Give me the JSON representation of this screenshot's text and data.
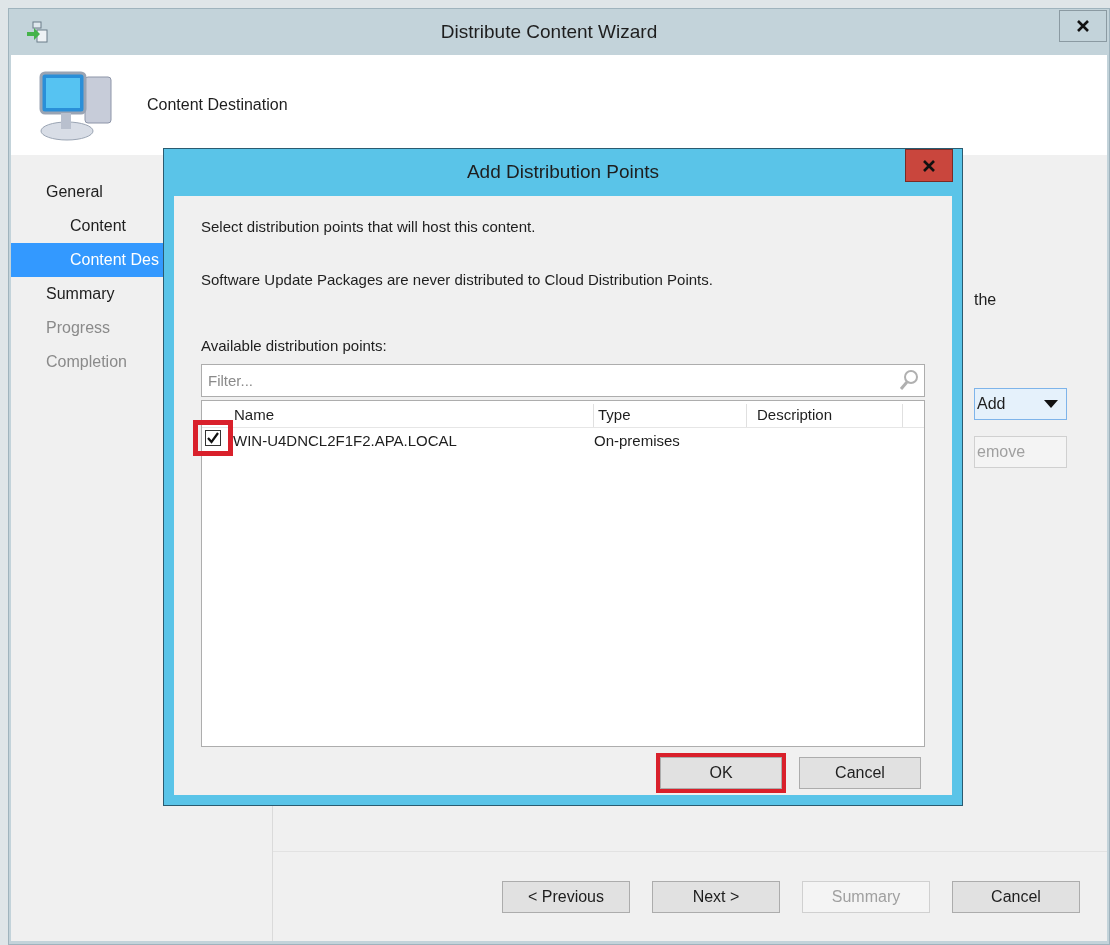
{
  "wizard": {
    "title": "Distribute Content Wizard",
    "page_heading": "Content Destination",
    "nav": [
      {
        "label": "General",
        "selected": false,
        "disabled": false,
        "children": [
          {
            "label": "Content",
            "selected": false,
            "disabled": false
          },
          {
            "label": "Content Des",
            "selected": true,
            "disabled": false
          }
        ]
      },
      {
        "label": "Summary",
        "selected": false,
        "disabled": false
      },
      {
        "label": "Progress",
        "selected": false,
        "disabled": true
      },
      {
        "label": "Completion",
        "selected": false,
        "disabled": true
      }
    ],
    "partial_text": "the",
    "side_buttons": [
      {
        "label": "Add",
        "disabled": false,
        "dropdown": true
      },
      {
        "label": "emove",
        "disabled": true,
        "dropdown": false
      }
    ],
    "footer_buttons": [
      {
        "label": "< Previous",
        "disabled": false
      },
      {
        "label": "Next >",
        "disabled": false
      },
      {
        "label": "Summary",
        "disabled": true
      },
      {
        "label": "Cancel",
        "disabled": false
      }
    ]
  },
  "dialog": {
    "title": "Add Distribution Points",
    "intro": "Select distribution points that will host this content.",
    "note": "Software Update Packages are never distributed to Cloud Distribution Points.",
    "list_label": "Available distribution points:",
    "filter": {
      "placeholder": "Filter..."
    },
    "columns": [
      "Name",
      "Type",
      "Description"
    ],
    "rows": [
      {
        "name": "WIN-U4DNCL2F1F2.APA.LOCAL",
        "type": "On-premises",
        "checked": true,
        "highlighted": true
      }
    ],
    "buttons": [
      {
        "label": "OK",
        "highlighted": true
      },
      {
        "label": "Cancel",
        "highlighted": false
      }
    ]
  }
}
